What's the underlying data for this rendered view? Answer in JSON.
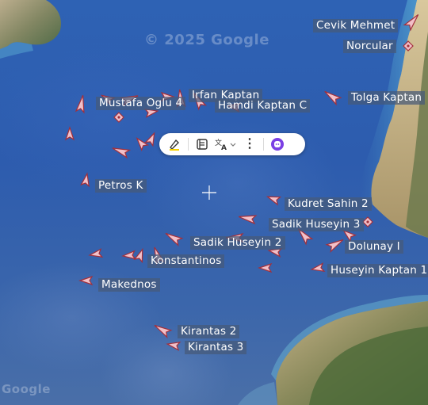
{
  "map": {
    "watermark_top": "© 2025 Google",
    "watermark_bottom": "Google"
  },
  "vessels": [
    {
      "name": "Cevik Mehmet"
    },
    {
      "name": "Norcular"
    },
    {
      "name": "Irfan Kaptan"
    },
    {
      "name": "Mustafa Oglu 4"
    },
    {
      "name": "Hamdi Kaptan C"
    },
    {
      "name": "Tolga Kaptan"
    },
    {
      "name": "Petros K"
    },
    {
      "name": "Kudret Sahin 2"
    },
    {
      "name": "Sadik Huseyin 3"
    },
    {
      "name": "Sadik Huseyin 2"
    },
    {
      "name": "Dolunay I"
    },
    {
      "name": "Konstantinos"
    },
    {
      "name": "Huseyin Kaptan 1"
    },
    {
      "name": "Makednos"
    },
    {
      "name": "Kirantas 2"
    },
    {
      "name": "Kirantas 3"
    }
  ],
  "toolbar": {
    "icons": [
      "highlighter-icon",
      "reader-icon",
      "translate-icon",
      "more-icon",
      "assistant-icon"
    ]
  }
}
